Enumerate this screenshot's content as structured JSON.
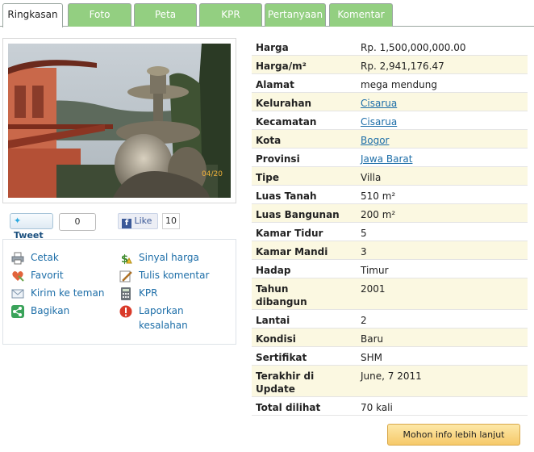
{
  "tabs": [
    {
      "label": "Ringkasan"
    },
    {
      "label": "Foto"
    },
    {
      "label": "Peta"
    },
    {
      "label": "KPR"
    },
    {
      "label": "Pertanyaan"
    },
    {
      "label": "Komentar"
    }
  ],
  "photo": {
    "timestamp": "04/20"
  },
  "social": {
    "tweet_label": "Tweet",
    "tweet_count": "0",
    "like_label": "Like",
    "like_count": "10"
  },
  "actions": {
    "print": "Cetak",
    "favorite": "Favorit",
    "send_friend": "Kirim ke teman",
    "share": "Bagikan",
    "price_signal": "Sinyal harga",
    "write_comment": "Tulis komentar",
    "kpr": "KPR",
    "report_line1": "Laporkan",
    "report_line2": "kesalahan"
  },
  "details": [
    {
      "label": "Harga",
      "value": "Rp. 1,500,000,000.00"
    },
    {
      "label": "Harga/m²",
      "value": "Rp. 2,941,176.47"
    },
    {
      "label": "Alamat",
      "value": "mega mendung"
    },
    {
      "label": "Kelurahan",
      "value": "Cisarua"
    },
    {
      "label": "Kecamatan",
      "value": "Cisarua"
    },
    {
      "label": "Kota",
      "value": "Bogor"
    },
    {
      "label": "Provinsi",
      "value": "Jawa Barat"
    },
    {
      "label": "Tipe",
      "value": "Villa"
    },
    {
      "label": "Luas Tanah",
      "value": "510 m²"
    },
    {
      "label": "Luas Bangunan",
      "value": "200 m²"
    },
    {
      "label": "Kamar Tidur",
      "value": "5"
    },
    {
      "label": "Kamar Mandi",
      "value": "3"
    },
    {
      "label": "Hadap",
      "value": "Timur"
    },
    {
      "label": "Tahun dibangun",
      "value": "2001"
    },
    {
      "label": "Lantai",
      "value": "2"
    },
    {
      "label": "Kondisi",
      "value": "Baru"
    },
    {
      "label": "Sertifikat",
      "value": "SHM"
    },
    {
      "label": "Terakhir di Update",
      "value": "June, 7 2011"
    },
    {
      "label": "Total dilihat",
      "value": "70 kali"
    }
  ],
  "more_button": "Mohon info lebih lanjut",
  "colors": {
    "tab_green": "#93cf81",
    "link": "#1d6ea8",
    "row_alt": "#fbf8e1",
    "button": "#f6c969"
  }
}
